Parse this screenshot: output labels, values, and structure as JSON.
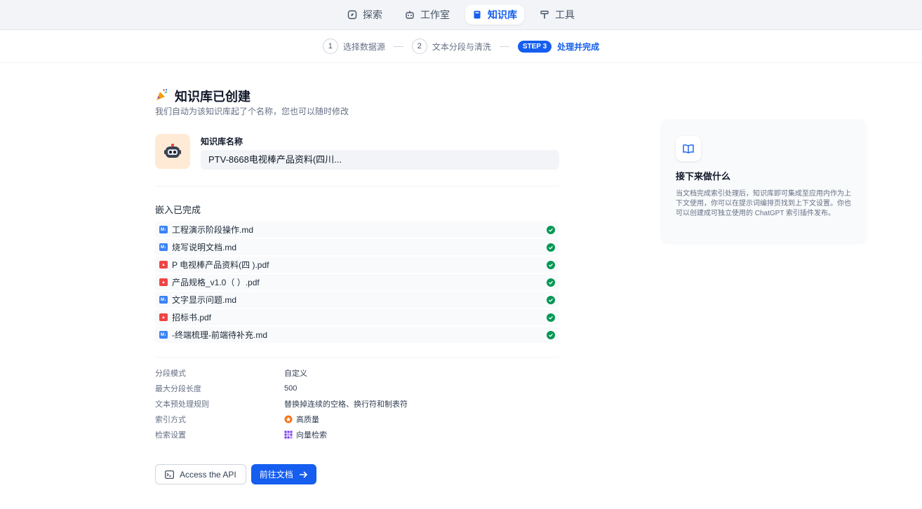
{
  "nav": {
    "items": [
      {
        "label": "探索",
        "icon": "compass-icon"
      },
      {
        "label": "工作室",
        "icon": "robot-icon"
      },
      {
        "label": "知识库",
        "icon": "book-icon",
        "active": true
      },
      {
        "label": "工具",
        "icon": "hammer-icon"
      }
    ]
  },
  "steps": {
    "step1_num": "1",
    "step1_label": "选择数据源",
    "step2_num": "2",
    "step2_label": "文本分段与清洗",
    "step3_badge": "STEP 3",
    "step3_label": "处理并完成"
  },
  "main": {
    "title": "知识库已创建",
    "subtitle": "我们自动为该知识库起了个名称，您也可以随时修改",
    "name_label": "知识库名称",
    "name_value": "PTV-8668电视棒产品资料(四川...",
    "embedding_title": "嵌入已完成",
    "files": [
      {
        "name": "工程演示阶段操作.md",
        "type": "md",
        "status": "completed"
      },
      {
        "name": "烧写说明文档.md",
        "type": "md",
        "status": "completed"
      },
      {
        "name": "P        电视棒产品资料(四        ).pdf",
        "type": "pdf",
        "status": "completed"
      },
      {
        "name": "                   产品规格_v1.0（           ）.pdf",
        "type": "pdf",
        "status": "completed"
      },
      {
        "name": "         文字显示问题.md",
        "type": "md",
        "status": "completed"
      },
      {
        "name": "招标书.pdf",
        "type": "pdf",
        "status": "completed"
      },
      {
        "name": "                      -终端梳理-前端待补充.md",
        "type": "md",
        "status": "completed"
      }
    ],
    "meta": [
      {
        "key": "分段模式",
        "value": "自定义",
        "icon": ""
      },
      {
        "key": "最大分段长度",
        "value": "500",
        "icon": ""
      },
      {
        "key": "文本预处理规则",
        "value": "替换掉连续的空格、换行符和制表符",
        "icon": ""
      },
      {
        "key": "索引方式",
        "value": "高质量",
        "icon": "quality-icon"
      },
      {
        "key": "检索设置",
        "value": "向量检索",
        "icon": "vector-grid-icon"
      }
    ],
    "api_button": "Access the API",
    "docs_button": "前往文档"
  },
  "side": {
    "title": "接下来做什么",
    "description": "当文档完成索引处理后，知识库即可集成至应用内作为上下文使用，你可以在提示词编排页找到上下文设置。你也可以创建成可独立使用的 ChatGPT 索引插件发布。"
  },
  "colors": {
    "accent": "#155eef",
    "success": "#039855",
    "md_icon": "#3b82f6",
    "pdf_icon": "#ef4444",
    "avatar_bg": "#ffead5"
  }
}
